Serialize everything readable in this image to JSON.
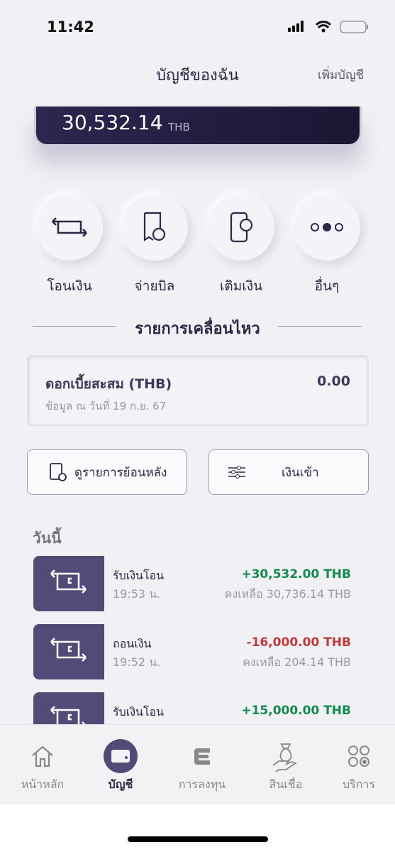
{
  "status": {
    "time": "11:42"
  },
  "header": {
    "title": "บัญชีของฉัน",
    "add_account": "เพิ่มบัญชี"
  },
  "account": {
    "balance": "30,532.14",
    "currency": "THB"
  },
  "quick_actions": [
    {
      "label": "โอนเงิน",
      "icon": "transfer-icon"
    },
    {
      "label": "จ่ายบิล",
      "icon": "bill-icon"
    },
    {
      "label": "เติมเงิน",
      "icon": "topup-phone-icon"
    },
    {
      "label": "อื่นๆ",
      "icon": "more-icon"
    }
  ],
  "section_title": "รายการเคลื่อนไหว",
  "interest": {
    "label": "ดอกเบี้ยสะสม (THB)",
    "value": "0.00",
    "note": "ข้อมูล ณ วันที่ 19 ก.ย. 67"
  },
  "buttons": {
    "history": "ดูรายการย้อนหลัง",
    "filter": "เงินเข้า"
  },
  "day_label": "วันนี้",
  "transactions": [
    {
      "name": "รับเงินโอน",
      "time": "19:53 น.",
      "amount": "+30,532.00 THB",
      "balance": "คงเหลือ 30,736.14 THB",
      "type": "in"
    },
    {
      "name": "ถอนเงิน",
      "time": "19:52 น.",
      "amount": "-16,000.00 THB",
      "balance": "คงเหลือ 204.14 THB",
      "type": "out"
    },
    {
      "name": "รับเงินโอน",
      "time": "",
      "amount": "+15,000.00 THB",
      "balance": "",
      "type": "in"
    }
  ],
  "tabs": [
    {
      "label": "หน้าหลัก",
      "icon": "home-icon"
    },
    {
      "label": "บัญชี",
      "icon": "wallet-icon",
      "active": true
    },
    {
      "label": "การลงทุน",
      "icon": "invest-icon"
    },
    {
      "label": "สินเชื่อ",
      "icon": "loan-icon"
    },
    {
      "label": "บริการ",
      "icon": "services-icon"
    }
  ],
  "colors": {
    "primary": "#544a78",
    "positive": "#138a4f",
    "negative": "#c0393b",
    "card": "#231c3d"
  }
}
